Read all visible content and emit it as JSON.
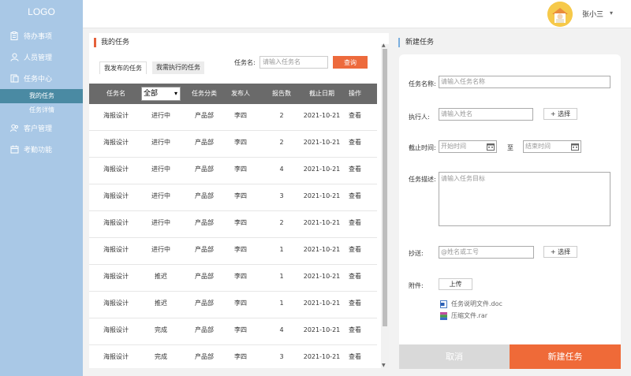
{
  "sidebar": {
    "logo": "LOGO",
    "items": [
      {
        "label": "待办事项",
        "icon": "clipboard-icon"
      },
      {
        "label": "人员管理",
        "icon": "user-icon"
      },
      {
        "label": "任务中心",
        "icon": "document-icon"
      }
    ],
    "sub_items": [
      {
        "label": "我的任务",
        "active": true
      },
      {
        "label": "任务详情",
        "active": false
      }
    ],
    "items_after": [
      {
        "label": "客户管理",
        "icon": "customer-icon"
      },
      {
        "label": "考勤功能",
        "icon": "calendar-icon"
      }
    ]
  },
  "header": {
    "username": "张小三",
    "caret": "▾"
  },
  "my_tasks": {
    "title": "我的任务",
    "tabs": [
      "我发布的任务",
      "我需执行的任务"
    ],
    "search_label": "任务名:",
    "search_placeholder": "请输入任务名",
    "query_label": "查询",
    "columns": {
      "name": "任务名",
      "status_filter": "全部",
      "category": "任务分类",
      "publisher": "发布人",
      "report_count": "报告数",
      "deadline": "截止日期",
      "action": "操作"
    },
    "rows": [
      {
        "name": "海报设计",
        "status": "进行中",
        "category": "产品部",
        "publisher": "李四",
        "reports": "2",
        "deadline": "2021-10-21",
        "action": "查看"
      },
      {
        "name": "海报设计",
        "status": "进行中",
        "category": "产品部",
        "publisher": "李四",
        "reports": "2",
        "deadline": "2021-10-21",
        "action": "查看"
      },
      {
        "name": "海报设计",
        "status": "进行中",
        "category": "产品部",
        "publisher": "李四",
        "reports": "4",
        "deadline": "2021-10-21",
        "action": "查看"
      },
      {
        "name": "海报设计",
        "status": "进行中",
        "category": "产品部",
        "publisher": "李四",
        "reports": "3",
        "deadline": "2021-10-21",
        "action": "查看"
      },
      {
        "name": "海报设计",
        "status": "进行中",
        "category": "产品部",
        "publisher": "李四",
        "reports": "2",
        "deadline": "2021-10-21",
        "action": "查看"
      },
      {
        "name": "海报设计",
        "status": "进行中",
        "category": "产品部",
        "publisher": "李四",
        "reports": "1",
        "deadline": "2021-10-21",
        "action": "查看"
      },
      {
        "name": "海报设计",
        "status": "推迟",
        "category": "产品部",
        "publisher": "李四",
        "reports": "1",
        "deadline": "2021-10-21",
        "action": "查看"
      },
      {
        "name": "海报设计",
        "status": "推迟",
        "category": "产品部",
        "publisher": "李四",
        "reports": "1",
        "deadline": "2021-10-21",
        "action": "查看"
      },
      {
        "name": "海报设计",
        "status": "完成",
        "category": "产品部",
        "publisher": "李四",
        "reports": "4",
        "deadline": "2021-10-21",
        "action": "查看"
      },
      {
        "name": "海报设计",
        "status": "完成",
        "category": "产品部",
        "publisher": "李四",
        "reports": "3",
        "deadline": "2021-10-21",
        "action": "查看"
      }
    ]
  },
  "new_task": {
    "title": "新建任务",
    "name_label": "任务名称:",
    "name_placeholder": "请输入任务名称",
    "executor_label": "执行人:",
    "executor_placeholder": "请输入姓名",
    "select_label": "+ 选择",
    "deadline_label": "截止时间:",
    "start_placeholder": "开始时间",
    "to_label": "至",
    "end_placeholder": "结束时间",
    "desc_label": "任务描述:",
    "desc_placeholder": "请输入任务目标",
    "cc_label": "抄送:",
    "cc_placeholder": "@姓名或工号",
    "attach_label": "附件:",
    "upload_label": "上传",
    "files": [
      {
        "name": "任务说明文件.doc",
        "icon": "word-doc-icon"
      },
      {
        "name": "压缩文件.rar",
        "icon": "rar-file-icon"
      }
    ],
    "cancel_label": "取消",
    "create_label": "新建任务"
  }
}
